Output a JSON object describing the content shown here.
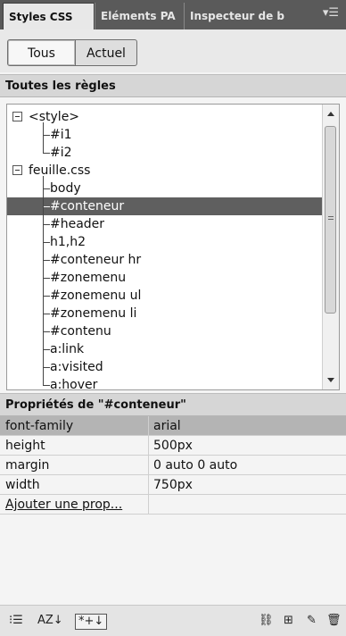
{
  "tabs": [
    {
      "label": "Styles CSS",
      "active": true
    },
    {
      "label": "Eléments PA",
      "active": false
    },
    {
      "label": "Inspecteur de b",
      "active": false
    }
  ],
  "tab_menu_icon": "▾☰",
  "toggles": {
    "all_label": "Tous",
    "current_label": "Actuel"
  },
  "rules_header": "Toutes les règles",
  "tree": [
    {
      "label": "<style>",
      "expandable": true,
      "selected": false
    },
    {
      "label": "#i1",
      "expandable": false,
      "selected": false
    },
    {
      "label": "#i2",
      "expandable": false,
      "selected": false
    },
    {
      "label": "feuille.css",
      "expandable": true,
      "selected": false
    },
    {
      "label": "body",
      "expandable": false,
      "selected": false
    },
    {
      "label": "#conteneur",
      "expandable": false,
      "selected": true
    },
    {
      "label": "#header",
      "expandable": false,
      "selected": false
    },
    {
      "label": "h1,h2",
      "expandable": false,
      "selected": false
    },
    {
      "label": "#conteneur hr",
      "expandable": false,
      "selected": false
    },
    {
      "label": "#zonemenu",
      "expandable": false,
      "selected": false
    },
    {
      "label": "#zonemenu ul",
      "expandable": false,
      "selected": false
    },
    {
      "label": "#zonemenu li",
      "expandable": false,
      "selected": false
    },
    {
      "label": "#contenu",
      "expandable": false,
      "selected": false
    },
    {
      "label": "a:link",
      "expandable": false,
      "selected": false
    },
    {
      "label": "a:visited",
      "expandable": false,
      "selected": false
    },
    {
      "label": "a:hover",
      "expandable": false,
      "selected": false
    }
  ],
  "props_header": "Propriétés de \"#conteneur\"",
  "properties": [
    {
      "name": "font-family",
      "value": "arial"
    },
    {
      "name": "height",
      "value": "500px"
    },
    {
      "name": "margin",
      "value": "0 auto 0 auto"
    },
    {
      "name": "width",
      "value": "750px"
    }
  ],
  "add_property_label": "Ajouter une prop...",
  "bottom_icons": {
    "category_view": "⁝☰",
    "alpha_view": "AZ↓",
    "set_props_view": "*+↓",
    "link": "⛓",
    "new_rule": "⊞",
    "edit": "✎",
    "delete": "🗑"
  },
  "colors": {
    "selected_row": "#5f5f5f",
    "tab_bar": "#5a5a5a"
  }
}
